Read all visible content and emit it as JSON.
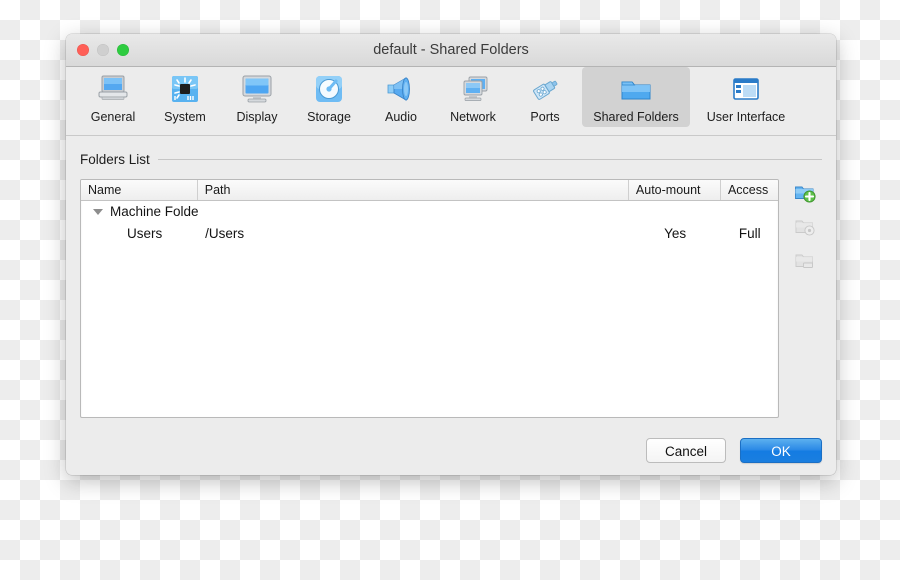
{
  "window": {
    "title": "default - Shared Folders",
    "traffic_lights": [
      {
        "name": "close",
        "color": "#ff5f57"
      },
      {
        "name": "minimize",
        "color": "#cfcfcf"
      },
      {
        "name": "maximize",
        "color": "#2ecc40"
      }
    ]
  },
  "toolbar": {
    "items": [
      {
        "label": "General",
        "icon": "laptop-icon",
        "selected": false
      },
      {
        "label": "System",
        "icon": "chip-icon",
        "selected": false
      },
      {
        "label": "Display",
        "icon": "monitor-icon",
        "selected": false
      },
      {
        "label": "Storage",
        "icon": "hard-disk-icon",
        "selected": false
      },
      {
        "label": "Audio",
        "icon": "speaker-icon",
        "selected": false
      },
      {
        "label": "Network",
        "icon": "network-monitors-icon",
        "selected": false
      },
      {
        "label": "Ports",
        "icon": "plug-icon",
        "selected": false
      },
      {
        "label": "Shared Folders",
        "icon": "folder-icon",
        "selected": true
      },
      {
        "label": "User Interface",
        "icon": "window-layout-icon",
        "selected": false
      }
    ]
  },
  "group": {
    "title": "Folders List"
  },
  "table": {
    "columns": [
      "Name",
      "Path",
      "Auto-mount",
      "Access"
    ],
    "rows": [
      {
        "type": "group",
        "name": "Machine Folders",
        "path": "",
        "auto_mount": "",
        "access": "",
        "expanded": true
      },
      {
        "type": "child",
        "name": "Users",
        "path": "/Users",
        "auto_mount": "Yes",
        "access": "Full"
      }
    ]
  },
  "side_actions": [
    {
      "name": "add-shared-folder",
      "icon": "folder-add-icon",
      "enabled": true
    },
    {
      "name": "edit-shared-folder",
      "icon": "folder-edit-icon",
      "enabled": false
    },
    {
      "name": "remove-shared-folder",
      "icon": "folder-remove-icon",
      "enabled": false
    }
  ],
  "footer": {
    "cancel_label": "Cancel",
    "ok_label": "OK"
  },
  "colors": {
    "accent_blue": "#1a7ee0",
    "window_bg": "#ececec",
    "selection_gray": "#d2d2d2"
  }
}
